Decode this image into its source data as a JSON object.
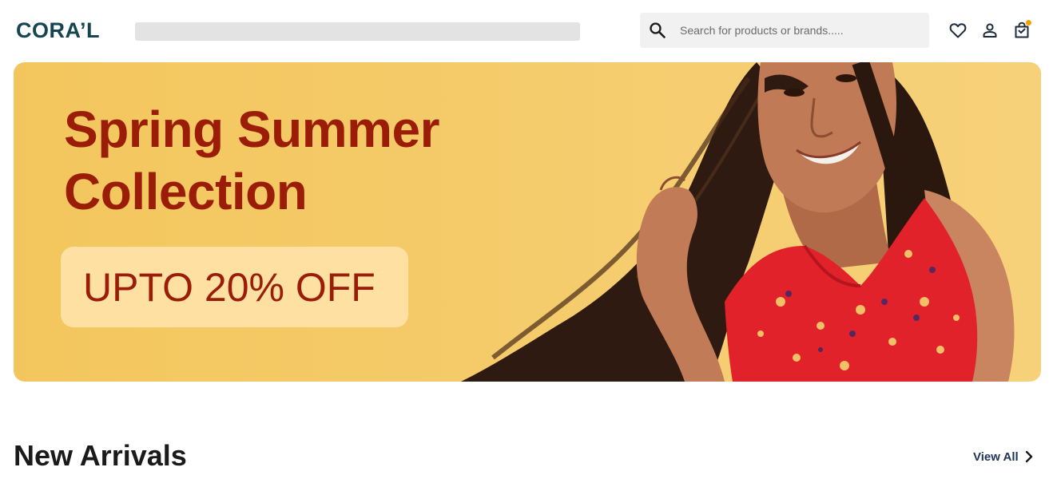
{
  "header": {
    "logo_text": "CORA’L",
    "search": {
      "placeholder": "Search for products or brands.....",
      "value": ""
    },
    "icons": {
      "search": "search-icon",
      "wishlist": "heart-icon",
      "account": "person-icon",
      "cart": "shopping-bag-icon"
    },
    "cart_indicator": true
  },
  "banner": {
    "title_line1": "Spring Summer",
    "title_line2": "Collection",
    "offer": "UPTO 20% OFF"
  },
  "new_arrivals": {
    "title": "New Arrivals",
    "view_all_label": "View All"
  },
  "colors": {
    "brand": "#16444f",
    "banner_bg": "#f2c862",
    "banner_text": "#9b1d08",
    "offer_pill": "#fde0a2",
    "cart_dot": "#f4a100",
    "dress_red": "#e2222b",
    "link": "#1d3557"
  }
}
